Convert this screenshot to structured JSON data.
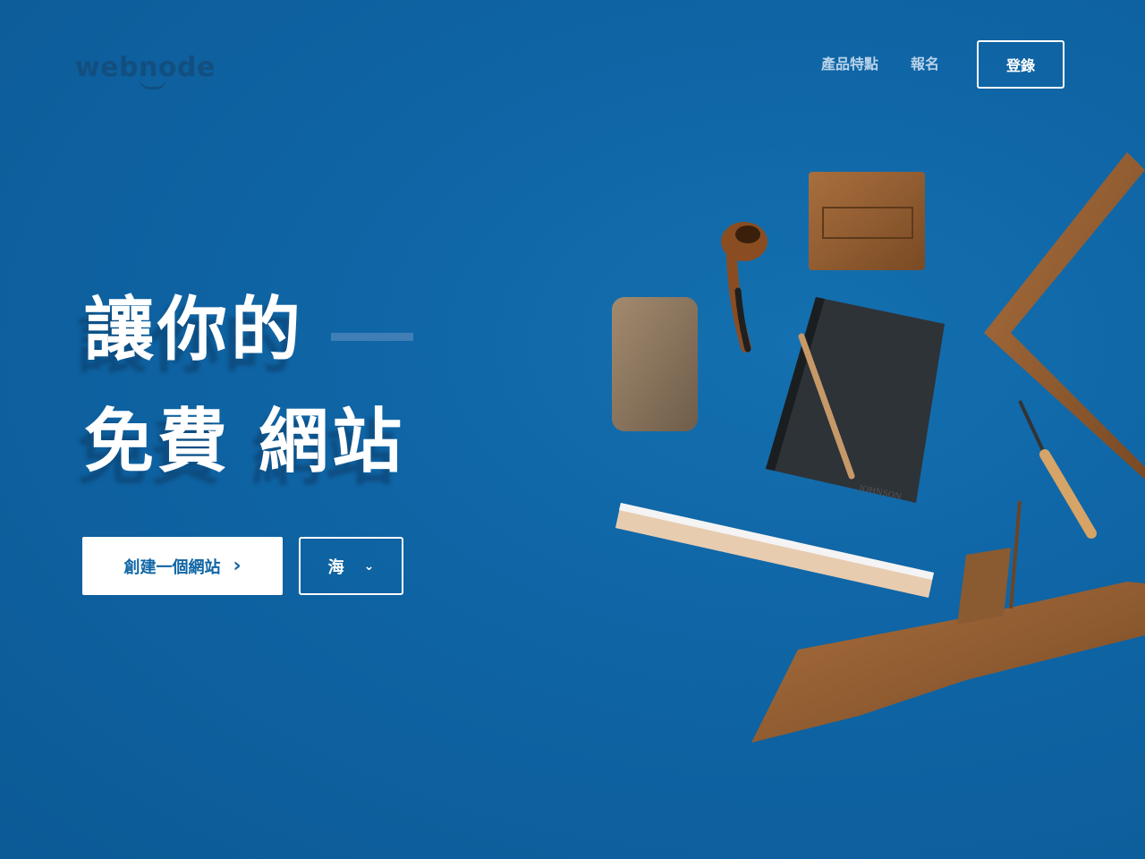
{
  "brand": {
    "logo_text": "webnode"
  },
  "nav": {
    "features": "產品特點",
    "signup": "報名",
    "login": "登錄"
  },
  "hero": {
    "line1": "讓你的",
    "line2_regular": "免費",
    "line2_bold": "網站"
  },
  "cta": {
    "create_label": "創建一個網站",
    "arrow": "›"
  },
  "language": {
    "selected": "海",
    "chevron": "⌄"
  },
  "artwork": {
    "ruler_label": "JOHNSON"
  },
  "colors": {
    "background": "#0f65a5",
    "accent_text": "#b8d2ea",
    "wood": "#8a5a30"
  }
}
